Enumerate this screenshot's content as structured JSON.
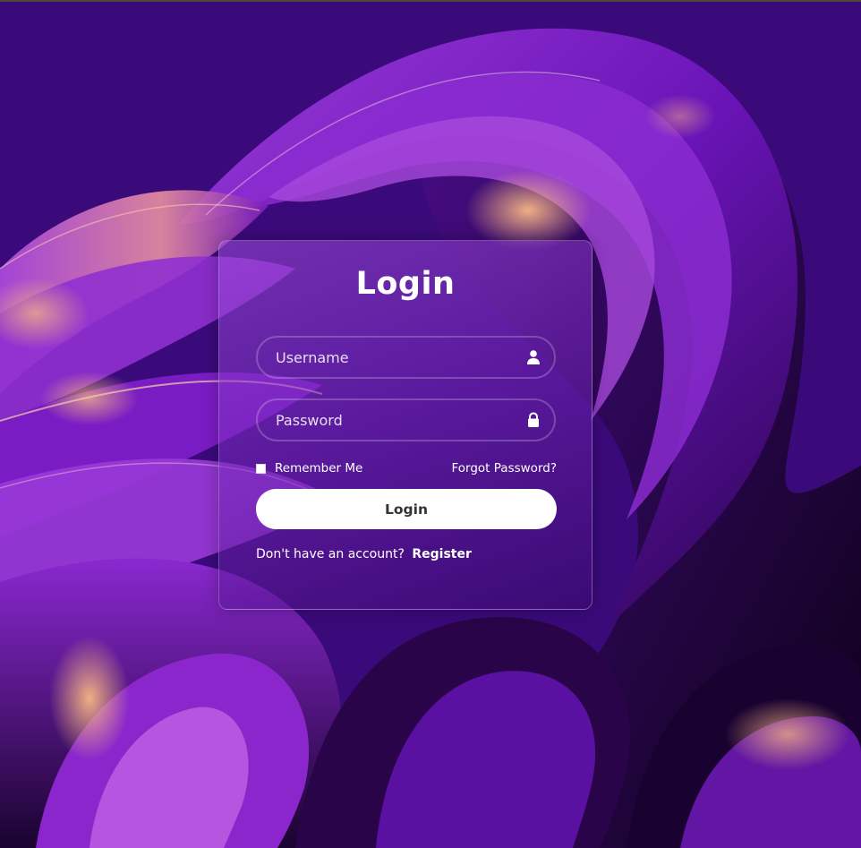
{
  "form": {
    "title": "Login",
    "username": {
      "placeholder": "Username",
      "value": "",
      "icon": "user-icon"
    },
    "password": {
      "placeholder": "Password",
      "value": "",
      "icon": "lock-icon"
    },
    "remember_label": "Remember Me",
    "remember_checked": false,
    "forgot_label": "Forgot Password?",
    "submit_label": "Login",
    "register_prompt": "Don't have an account?",
    "register_label": "Register"
  },
  "colors": {
    "background": "#3a0a7a",
    "accent_pink": "#f0a07a",
    "button_bg": "#ffffff",
    "button_text": "#333333",
    "text": "#ffffff"
  }
}
